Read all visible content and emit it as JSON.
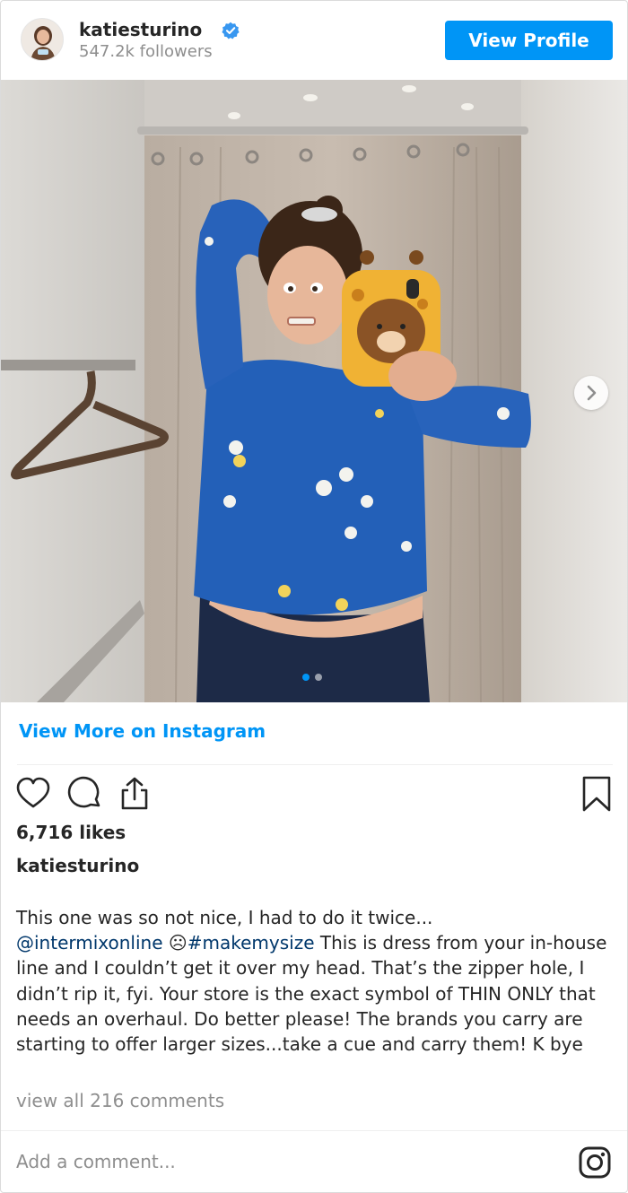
{
  "header": {
    "username": "katiesturino",
    "followers": "547.2k followers",
    "view_profile_label": "View Profile"
  },
  "post": {
    "carousel_count": 2,
    "active_index": 0,
    "view_more_label": "View More on Instagram",
    "likes": "6,716 likes",
    "caption_username": "katiesturino",
    "caption_text_1": "This one was so not nice, I had to do it twice...",
    "mention": "@intermixonline",
    "emoji": "☹",
    "hashtag": "#makemysize",
    "caption_text_2": " This is dress from your in-house line and I couldn’t get it over my head. That’s the zipper hole, I didn’t rip it, fyi. Your store is the exact symbol of THIN ONLY that needs an overhaul. Do better please! The brands you carry are starting to offer larger sizes...take a cue and carry them! K bye",
    "view_comments_label": "view all 216 comments"
  },
  "comment_box": {
    "placeholder": "Add a comment..."
  },
  "icons": {
    "like": "heart-icon",
    "comment": "comment-bubble-icon",
    "share": "share-icon",
    "save": "bookmark-icon",
    "brand": "instagram-icon",
    "verified": "verified-badge-icon",
    "next": "chevron-right-icon"
  },
  "colors": {
    "accent": "#0095f6",
    "link": "#00376b",
    "secondary_text": "#8e8e8e",
    "primary_text": "#262626"
  }
}
